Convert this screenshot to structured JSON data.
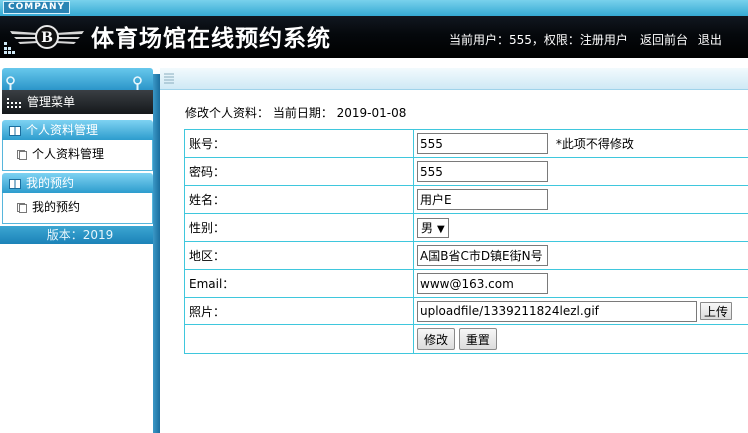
{
  "header": {
    "company_badge": "COMPANY",
    "logo_letter": "B",
    "title": "体育场馆在线预约系统",
    "user_info": "当前用户：555，权限：注册用户",
    "links": [
      "返回前台",
      "退出"
    ]
  },
  "sidebar": {
    "menu_title": "管理菜单",
    "groups": [
      {
        "title": "个人资料管理",
        "items": [
          "个人资料管理"
        ]
      },
      {
        "title": "我的预约",
        "items": [
          "我的预约"
        ]
      }
    ],
    "version": "版本：2019"
  },
  "page": {
    "title": "修改个人资料： 当前日期： 2019-01-08"
  },
  "form": {
    "account": {
      "label": "账号：",
      "value": "555",
      "note": "*此项不得修改"
    },
    "password": {
      "label": "密码：",
      "value": "555"
    },
    "name": {
      "label": "姓名：",
      "value": "用户E"
    },
    "gender": {
      "label": "性别：",
      "value": "男"
    },
    "region": {
      "label": "地区：",
      "value": "A国B省C市D镇E街N号"
    },
    "email": {
      "label": "Email：",
      "value": "www@163.com"
    },
    "photo": {
      "label": "照片：",
      "value": "uploadfile/1339211824lezl.gif",
      "upload_label": "上传"
    },
    "submit_label": "修改",
    "reset_label": "重置"
  },
  "colors": {
    "header_stripe": "#4fbbe2",
    "table_border": "#3fc7dd",
    "sidebar_accent": "#2d9ccd"
  }
}
